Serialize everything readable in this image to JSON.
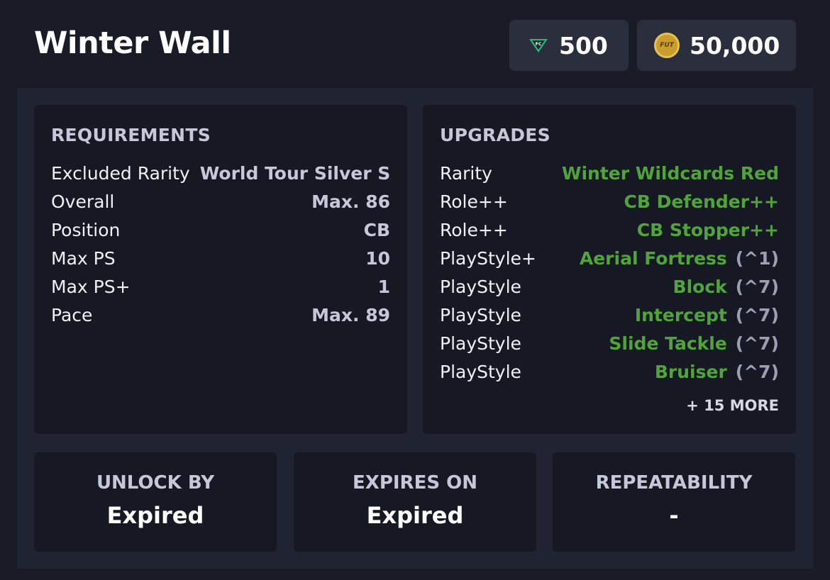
{
  "header": {
    "title": "Winter Wall",
    "points": "500",
    "points_icon": "fc-points-gem-icon",
    "coins": "50,000",
    "coins_icon": "fut-coin-icon",
    "coin_text": "FUT"
  },
  "requirements": {
    "title": "REQUIREMENTS",
    "rows": [
      {
        "label": "Excluded Rarity",
        "value": "World Tour Silver S"
      },
      {
        "label": "Overall",
        "value": "Max. 86"
      },
      {
        "label": "Position",
        "value": "CB"
      },
      {
        "label": "Max PS",
        "value": "10"
      },
      {
        "label": "Max PS+",
        "value": "1"
      },
      {
        "label": "Pace",
        "value": "Max. 89"
      }
    ]
  },
  "upgrades": {
    "title": "UPGRADES",
    "rows": [
      {
        "label": "Rarity",
        "value": "Winter Wildcards Red",
        "cap": ""
      },
      {
        "label": "Role++",
        "value": "CB Defender++",
        "cap": ""
      },
      {
        "label": "Role++",
        "value": "CB Stopper++",
        "cap": ""
      },
      {
        "label": "PlayStyle+",
        "value": "Aerial Fortress",
        "cap": "(^1)"
      },
      {
        "label": "PlayStyle",
        "value": "Block",
        "cap": "(^7)"
      },
      {
        "label": "PlayStyle",
        "value": "Intercept",
        "cap": "(^7)"
      },
      {
        "label": "PlayStyle",
        "value": "Slide Tackle",
        "cap": "(^7)"
      },
      {
        "label": "PlayStyle",
        "value": "Bruiser",
        "cap": "(^7)"
      }
    ],
    "more": "+ 15 MORE"
  },
  "stats": {
    "unlock_by": {
      "label": "UNLOCK BY",
      "value": "Expired"
    },
    "expires_on": {
      "label": "EXPIRES ON",
      "value": "Expired"
    },
    "repeatability": {
      "label": "REPEATABILITY",
      "value": "-"
    }
  },
  "colors": {
    "accent_green": "#51a43b",
    "background": "#191c27",
    "card": "#161924"
  }
}
